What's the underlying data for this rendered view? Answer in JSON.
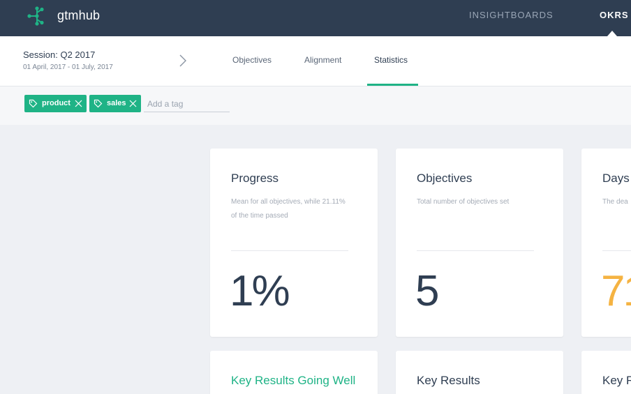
{
  "header": {
    "brand": "gtmhub",
    "nav": [
      {
        "label": "INSIGHTBOARDS"
      },
      {
        "label": "OKRS"
      }
    ]
  },
  "session": {
    "title": "Session: Q2 2017",
    "dates": "01 April, 2017 - 01 July, 2017"
  },
  "tabs": [
    {
      "label": "Objectives"
    },
    {
      "label": "Alignment"
    },
    {
      "label": "Statistics",
      "active": true
    }
  ],
  "tags": {
    "items": [
      {
        "label": "product"
      },
      {
        "label": "sales"
      }
    ],
    "input_placeholder": "Add a tag"
  },
  "cards": [
    {
      "title": "Progress",
      "description": "Mean for all objectives, while 21.11% of the time passed",
      "value": "1%"
    },
    {
      "title": "Objectives",
      "description": "Total number of objectives set",
      "value": "5"
    },
    {
      "title": "Days",
      "description": "The dea",
      "value": "71"
    },
    {
      "title": "Key Results Going Well"
    },
    {
      "title": "Key Results"
    },
    {
      "title": "Key R"
    }
  ],
  "colors": {
    "accent": "#1fb386",
    "header_bg": "#2f3e52",
    "value_orange": "#f5b342"
  }
}
